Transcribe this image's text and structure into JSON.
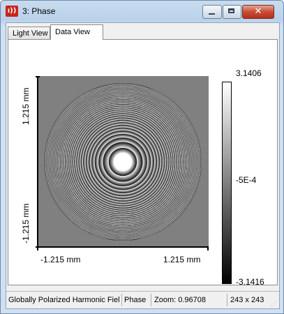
{
  "window": {
    "title": "3: Phase",
    "icon": "app-red-icon"
  },
  "controls": {
    "minimize": "minimize-icon",
    "maximize": "maximize-icon",
    "close_glyph": "✕"
  },
  "tabs": [
    {
      "label": "Light View",
      "active": false
    },
    {
      "label": "Data View",
      "active": true
    }
  ],
  "plot": {
    "y_top_label": "1.215 mm",
    "y_bottom_label": "-1.215 mm",
    "x_left_label": "-1.215 mm",
    "x_right_label": "1.215 mm",
    "background_color": "#808080"
  },
  "colorbar": {
    "max_label": "3.1406",
    "mid_label": "-5E-4",
    "min_label": "-3.1416",
    "gradient_top": "#ffffff",
    "gradient_bottom": "#000000"
  },
  "status": {
    "source": "Globally Polarized Harmonic Fiel",
    "quantity": "Phase",
    "zoom": "Zoom: 0.96708",
    "size": "243 x 243"
  }
}
